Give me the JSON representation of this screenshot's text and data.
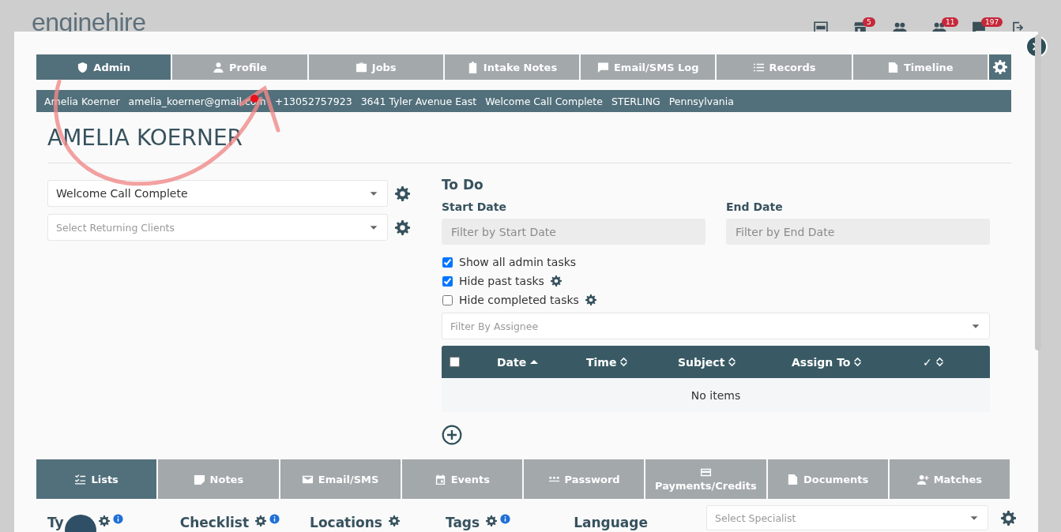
{
  "header": {
    "logo": "enginehire",
    "icons": [
      {
        "kind": "new"
      },
      {
        "kind": "store",
        "badge": "5"
      },
      {
        "kind": "people"
      },
      {
        "kind": "people",
        "badge": "11"
      },
      {
        "kind": "chat",
        "badge": "197"
      },
      {
        "kind": "logout"
      }
    ]
  },
  "tabs": [
    {
      "label": "Admin",
      "kind": "shield",
      "selected": true
    },
    {
      "label": "Profile",
      "kind": "person",
      "selected": false
    },
    {
      "label": "Jobs",
      "kind": "briefcase",
      "selected": false
    },
    {
      "label": "Intake Notes",
      "kind": "clipboard",
      "selected": false
    },
    {
      "label": "Email/SMS Log",
      "kind": "chat",
      "selected": false
    },
    {
      "label": "Records",
      "kind": "list",
      "selected": false
    },
    {
      "label": "Timeline",
      "kind": "doc",
      "selected": false
    }
  ],
  "info_bar": [
    "Amelia Koerner",
    "amelia_koerner@gmail.com",
    "+13052757923",
    "3641 Tyler Avenue East",
    "Welcome Call Complete",
    "STERLING",
    "Pennsylvania"
  ],
  "client_name": "AMELIA KOERNER",
  "status_select": {
    "value": "Welcome Call Complete"
  },
  "returning_select": {
    "placeholder": "Select Returning Clients"
  },
  "todo": {
    "title": "To Do",
    "start_label": "Start Date",
    "start_placeholder": "Filter by Start Date",
    "end_label": "End Date",
    "end_placeholder": "Filter by End Date",
    "options": [
      {
        "label": "Show all admin tasks",
        "checked": true,
        "gear": false
      },
      {
        "label": "Hide past tasks",
        "checked": true,
        "gear": true
      },
      {
        "label": "Hide completed tasks",
        "checked": false,
        "gear": true
      }
    ],
    "assignee_placeholder": "Filter By Assignee",
    "all_selected": false,
    "columns": [
      {
        "label": "Date",
        "sorted_ascending": true
      },
      {
        "label": "Time",
        "sorted_ascending": false
      },
      {
        "label": "Subject",
        "sorted_ascending": false
      },
      {
        "label": "Assign To",
        "sorted_ascending": false
      },
      {
        "label": "✓",
        "sorted_ascending": false
      }
    ],
    "empty": "No items"
  },
  "bottom_tabs": [
    {
      "label": "Lists",
      "kind": "checklist",
      "selected": true
    },
    {
      "label": "Notes",
      "kind": "note",
      "selected": false
    },
    {
      "label": "Email/SMS",
      "kind": "mail",
      "selected": false
    },
    {
      "label": "Events",
      "kind": "calendar",
      "selected": false
    },
    {
      "label": "Password",
      "kind": "dots",
      "selected": false
    },
    {
      "label": "Payments/Credits",
      "kind": "card",
      "selected": false
    },
    {
      "label": "Documents",
      "kind": "doc",
      "selected": false
    },
    {
      "label": "Matches",
      "kind": "personplus",
      "selected": false
    }
  ],
  "sections": [
    {
      "label": "Ty",
      "gear": true,
      "info": true
    },
    {
      "label": "Checklist",
      "gear": true,
      "info": true
    },
    {
      "label": "Locations",
      "gear": true,
      "info": false
    },
    {
      "label": "Tags",
      "gear": true,
      "info": true
    },
    {
      "label": "Language",
      "gear": false,
      "info": false
    }
  ],
  "specialist_select": {
    "placeholder": "Select Specialist"
  }
}
